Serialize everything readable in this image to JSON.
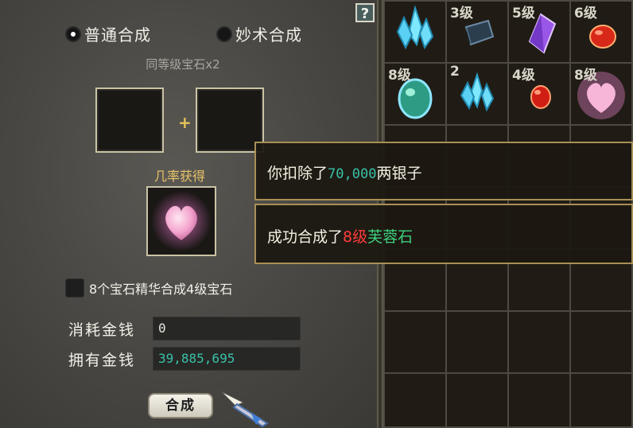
{
  "window": {
    "help_label": "?"
  },
  "synthesis": {
    "mode_normal": "普通合成",
    "mode_special": "妙术合成",
    "requirement": "同等级宝石x2",
    "plus": "+",
    "probability_label": "几率获得",
    "checkbox_label": "8个宝石精华合成4级宝石",
    "cost_label": "消耗金钱",
    "cost_value": "0",
    "owned_label": "拥有金钱",
    "owned_value": "39,885,695",
    "craft_button": "合成"
  },
  "inventory": {
    "row1": [
      {
        "level": "",
        "icon": "blue-crystal-icon"
      },
      {
        "level": "3级",
        "icon": "dark-stone-icon"
      },
      {
        "level": "5级",
        "icon": "purple-gem-icon"
      },
      {
        "level": "6级",
        "icon": "red-gem-icon"
      }
    ],
    "row2": [
      {
        "level": "8级",
        "icon": "green-jade-icon"
      },
      {
        "level": "2",
        "icon": "blue-crystal-icon"
      },
      {
        "level": "4级",
        "icon": "red-gem-icon"
      },
      {
        "level": "8级",
        "icon": "pink-heart-stone-icon"
      }
    ]
  },
  "messages": {
    "deduct_prefix": "你扣除了",
    "deduct_amount": "70,000",
    "deduct_suffix": "两银子",
    "success_prefix": "成功合成了",
    "success_level": "8级",
    "success_item": "芙蓉石"
  },
  "colors": {
    "gold": "#e8c46a",
    "teal": "#39c1a8",
    "green": "#3dd07c",
    "red": "#ff3c3c"
  }
}
